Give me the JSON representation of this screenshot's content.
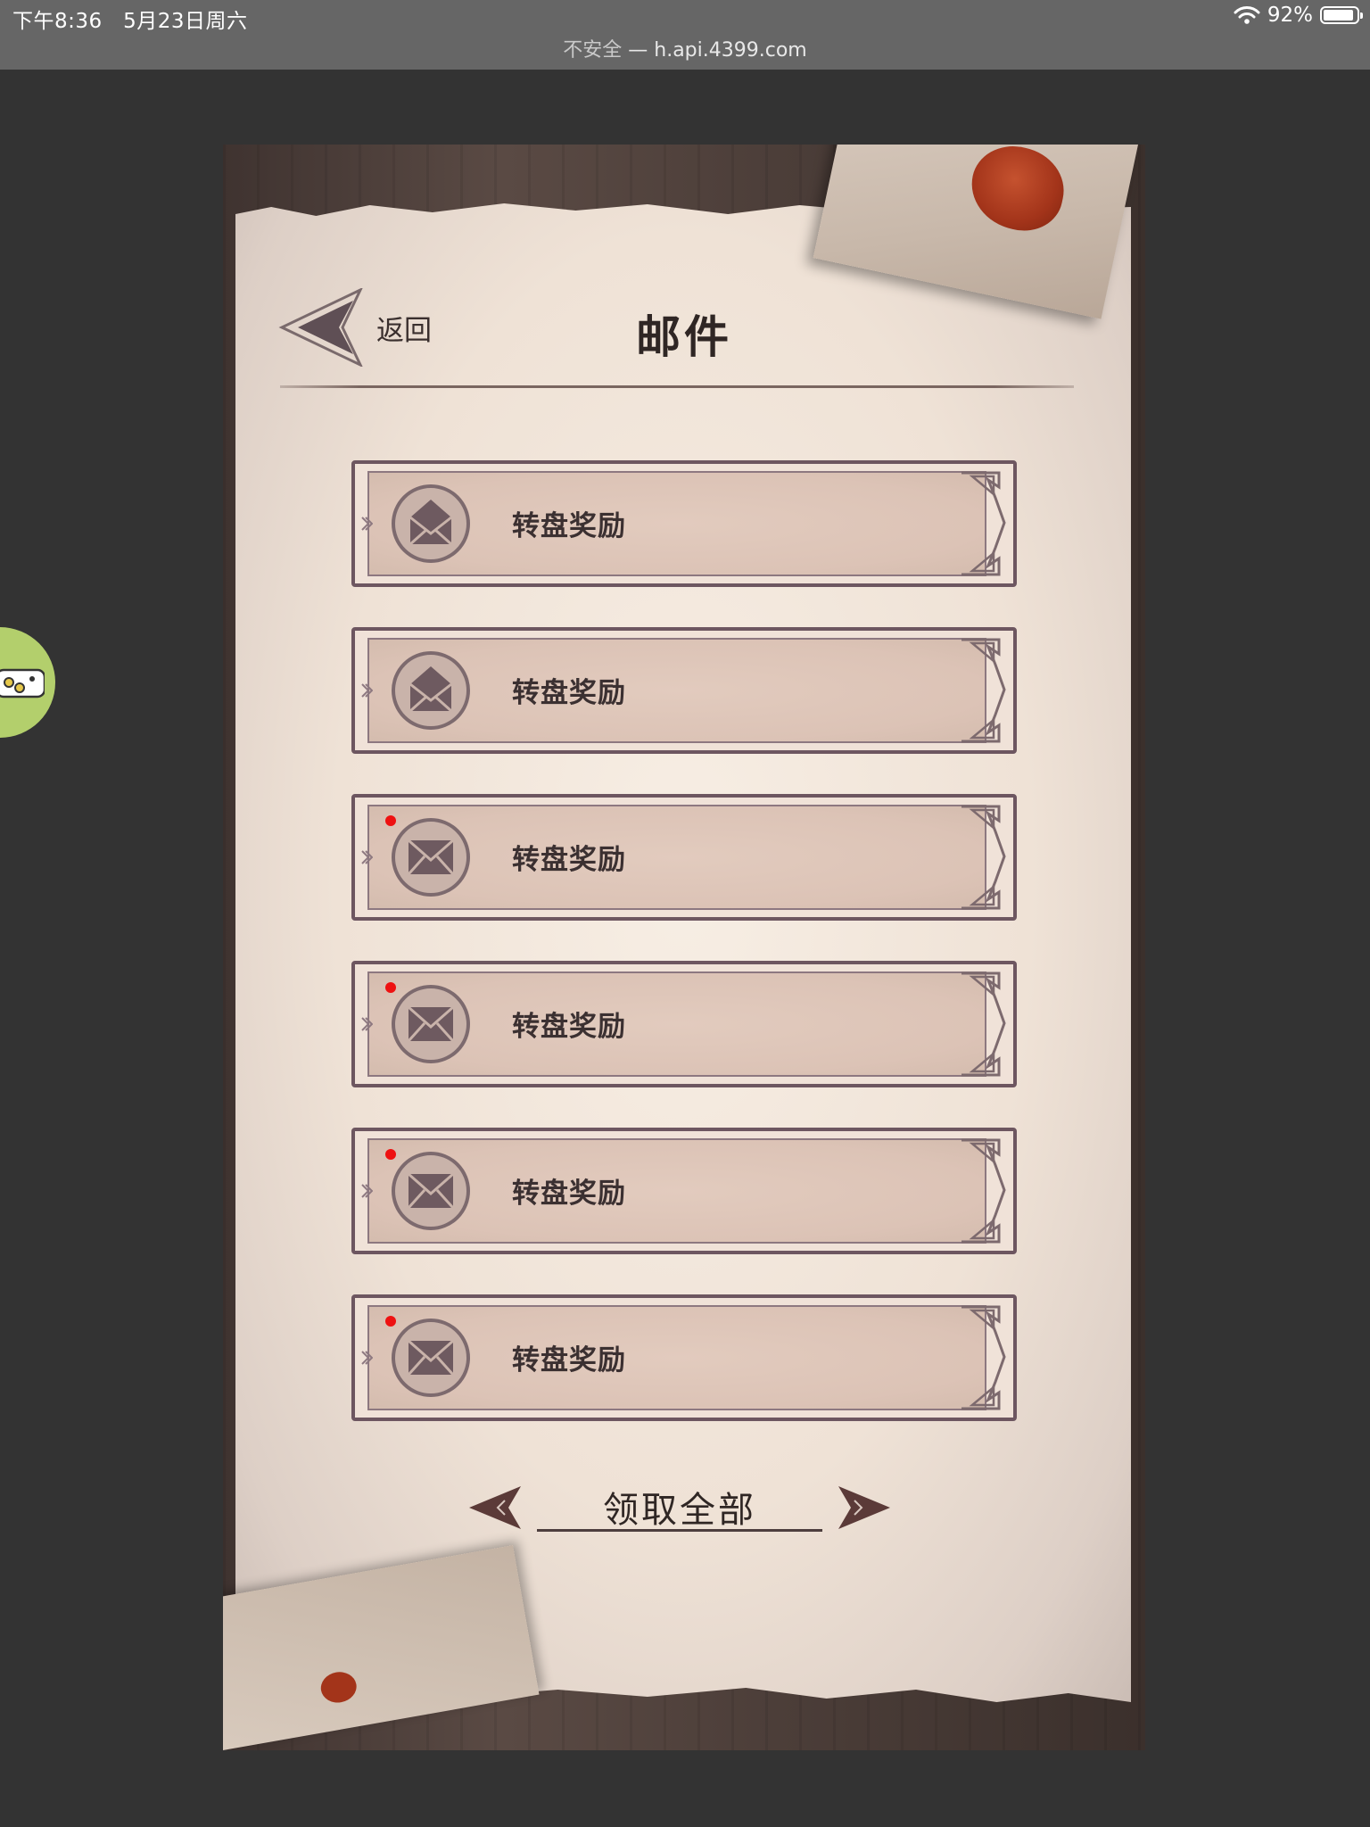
{
  "status_bar": {
    "time": "下午8:36",
    "date": "5月23日周六",
    "battery": "92%",
    "battery_level": 0.92
  },
  "browser": {
    "security": "不安全",
    "separator": "—",
    "url": "h.api.4399.com"
  },
  "header": {
    "back_label": "返回",
    "title": "邮件"
  },
  "mails": [
    {
      "label": "转盘奖励",
      "read": true
    },
    {
      "label": "转盘奖励",
      "read": true
    },
    {
      "label": "转盘奖励",
      "read": false
    },
    {
      "label": "转盘奖励",
      "read": false
    },
    {
      "label": "转盘奖励",
      "read": false
    },
    {
      "label": "转盘奖励",
      "read": false
    }
  ],
  "footer": {
    "claim_all_label": "领取全部"
  },
  "icons": {
    "back": "back-arrow-icon",
    "mail_opened": "opened-envelope-icon",
    "mail_closed": "closed-envelope-icon",
    "unread": "unread-dot",
    "float": "gamepad-icon"
  },
  "colors": {
    "unread_dot": "#ee1111",
    "frame": "#6d5660",
    "widget": "#b3cf6c"
  }
}
